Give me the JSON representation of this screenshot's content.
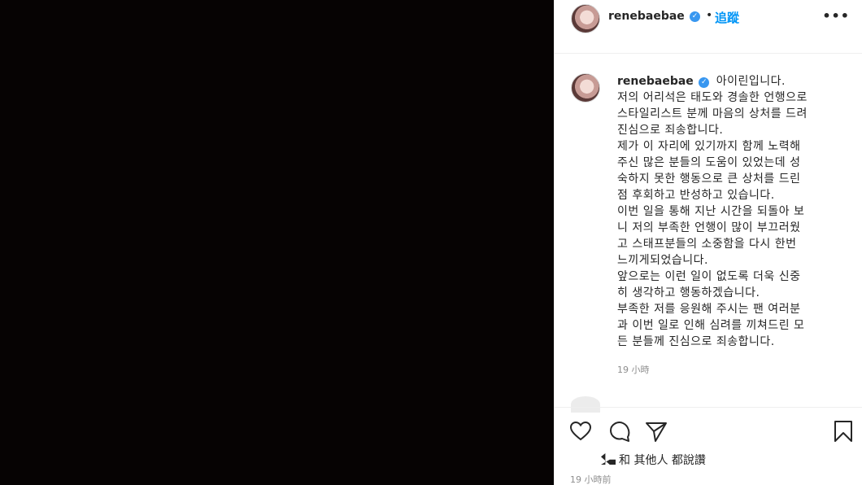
{
  "media": {
    "background": "#060303"
  },
  "header": {
    "username": "renebaebae",
    "separator": "•",
    "follow_label": "追蹤",
    "more_label": "•••"
  },
  "caption": {
    "username": "renebaebae",
    "text": "아이린입니다.\n저의 어리석은 태도와 경솔한 언행으로\n스타일리스트 분께 마음의 상처를 드려\n진심으로 죄송합니다.\n제가 이 자리에 있기까지 함께 노력해\n주신 많은 분들의 도움이 있었는데 성\n숙하지 못한 행동으로 큰 상처를 드린\n점 후회하고 반성하고 있습니다.\n이번 일을 통해 지난 시간을 되돌아 보\n니 저의 부족한 언행이 많이 부끄러웠\n고 스태프분들의 소중함을 다시 한번\n느끼게되었습니다.\n앞으로는 이런 일이 없도록 더욱 신중\n히 생각하고 행동하겠습니다.\n부족한 저를 응원해 주시는 팬 여러분\n과 이번 일로 인해 심려를 끼쳐드린 모\n든 분들께 진심으로 죄송합니다.",
    "time_ago": "19 小時"
  },
  "comment_peek": {
    "text": "..."
  },
  "likes": {
    "text": "和 其他人 都說讚"
  },
  "post_date": "19 小時前",
  "colors": {
    "link": "#0095f6",
    "verified": "#3897f0",
    "muted": "#8e8e8e"
  },
  "icons": [
    "heart-icon",
    "comment-icon",
    "share-icon",
    "bookmark-icon",
    "verified-icon"
  ]
}
